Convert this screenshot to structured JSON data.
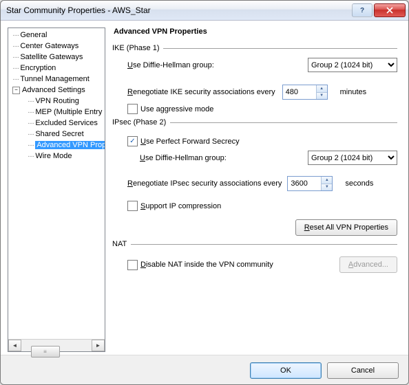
{
  "window": {
    "title": "Star Community Properties - AWS_Star",
    "help": "?",
    "close": "×"
  },
  "tree": {
    "items": [
      {
        "label": "General",
        "child": false
      },
      {
        "label": "Center Gateways",
        "child": false
      },
      {
        "label": "Satellite Gateways",
        "child": false
      },
      {
        "label": "Encryption",
        "child": false
      },
      {
        "label": "Tunnel Management",
        "child": false
      },
      {
        "label": "Advanced Settings",
        "child": false,
        "expander": "−"
      },
      {
        "label": "VPN Routing",
        "child": true
      },
      {
        "label": "MEP (Multiple Entry Point)",
        "child": true
      },
      {
        "label": "Excluded Services",
        "child": true
      },
      {
        "label": "Shared Secret",
        "child": true
      },
      {
        "label": "Advanced VPN Properties",
        "child": true,
        "selected": true
      },
      {
        "label": "Wire Mode",
        "child": true
      }
    ]
  },
  "main": {
    "heading": "Advanced VPN Properties",
    "ike": {
      "group_label": "IKE (Phase 1)",
      "dh_label_pre": "U",
      "dh_label_post": "se Diffie-Hellman group:",
      "dh_value": "Group  2 (1024 bit)",
      "reneg_pre": "R",
      "reneg_post": "enegotiate IKE security associations every",
      "reneg_value": "480",
      "reneg_unit": "minutes",
      "aggressive_label": "Use aggressive mode",
      "aggressive_checked": false
    },
    "ipsec": {
      "group_label": "IPsec (Phase 2)",
      "pfs_pre": "U",
      "pfs_post": "se Perfect Forward Secrecy",
      "pfs_checked": true,
      "dh_label_pre": "U",
      "dh_label_post": "se Diffie-Hellman group:",
      "dh_value": "Group  2 (1024 bit)",
      "reneg_pre": "R",
      "reneg_post": "enegotiate IPsec security associations every",
      "reneg_value": "3600",
      "reneg_unit": "seconds",
      "compress_pre": "S",
      "compress_post": "upport IP compression",
      "compress_checked": false,
      "reset_pre": "R",
      "reset_post": "eset All VPN Properties"
    },
    "nat": {
      "group_label": "NAT",
      "disable_pre": "D",
      "disable_post": "isable NAT inside the VPN community",
      "disable_checked": false,
      "adv_pre": "A",
      "adv_post": "dvanced..."
    }
  },
  "footer": {
    "ok": "OK",
    "cancel": "Cancel"
  }
}
